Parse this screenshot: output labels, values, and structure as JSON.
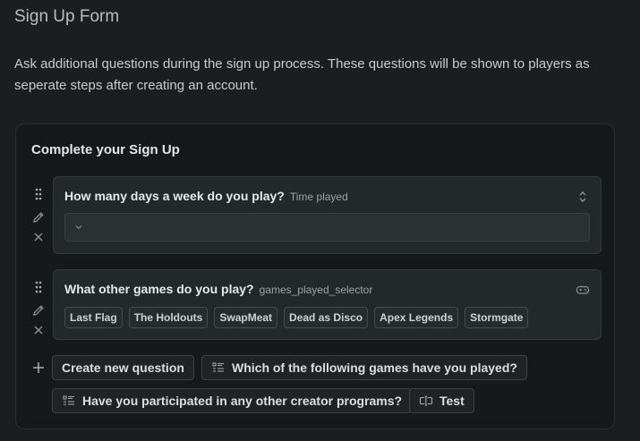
{
  "page": {
    "title": "Sign Up Form",
    "description": "Ask additional questions during the sign up process. These questions will be shown to players as seperate steps after creating an account."
  },
  "card": {
    "title": "Complete your Sign Up",
    "questions": [
      {
        "label": "How many days a week do you play?",
        "sub": "Time played",
        "type": "select",
        "icon": "select-icon"
      },
      {
        "label": "What other games do you play?",
        "sub": "games_played_selector",
        "type": "chips",
        "icon": "gamepad-icon",
        "options": [
          "Last Flag",
          "The Holdouts",
          "SwapMeat",
          "Dead as Disco",
          "Apex Legends",
          "Stormgate"
        ]
      }
    ],
    "actions": {
      "create": "Create new question",
      "saved1": "Which of the following games have you played?",
      "saved2": "Have you participated in any other creator programs?",
      "saved3": "Test"
    }
  },
  "colors": {
    "background": "#1b1e1e",
    "card": "#161919",
    "question_box": "#232828",
    "text": "#d6d9d9"
  }
}
